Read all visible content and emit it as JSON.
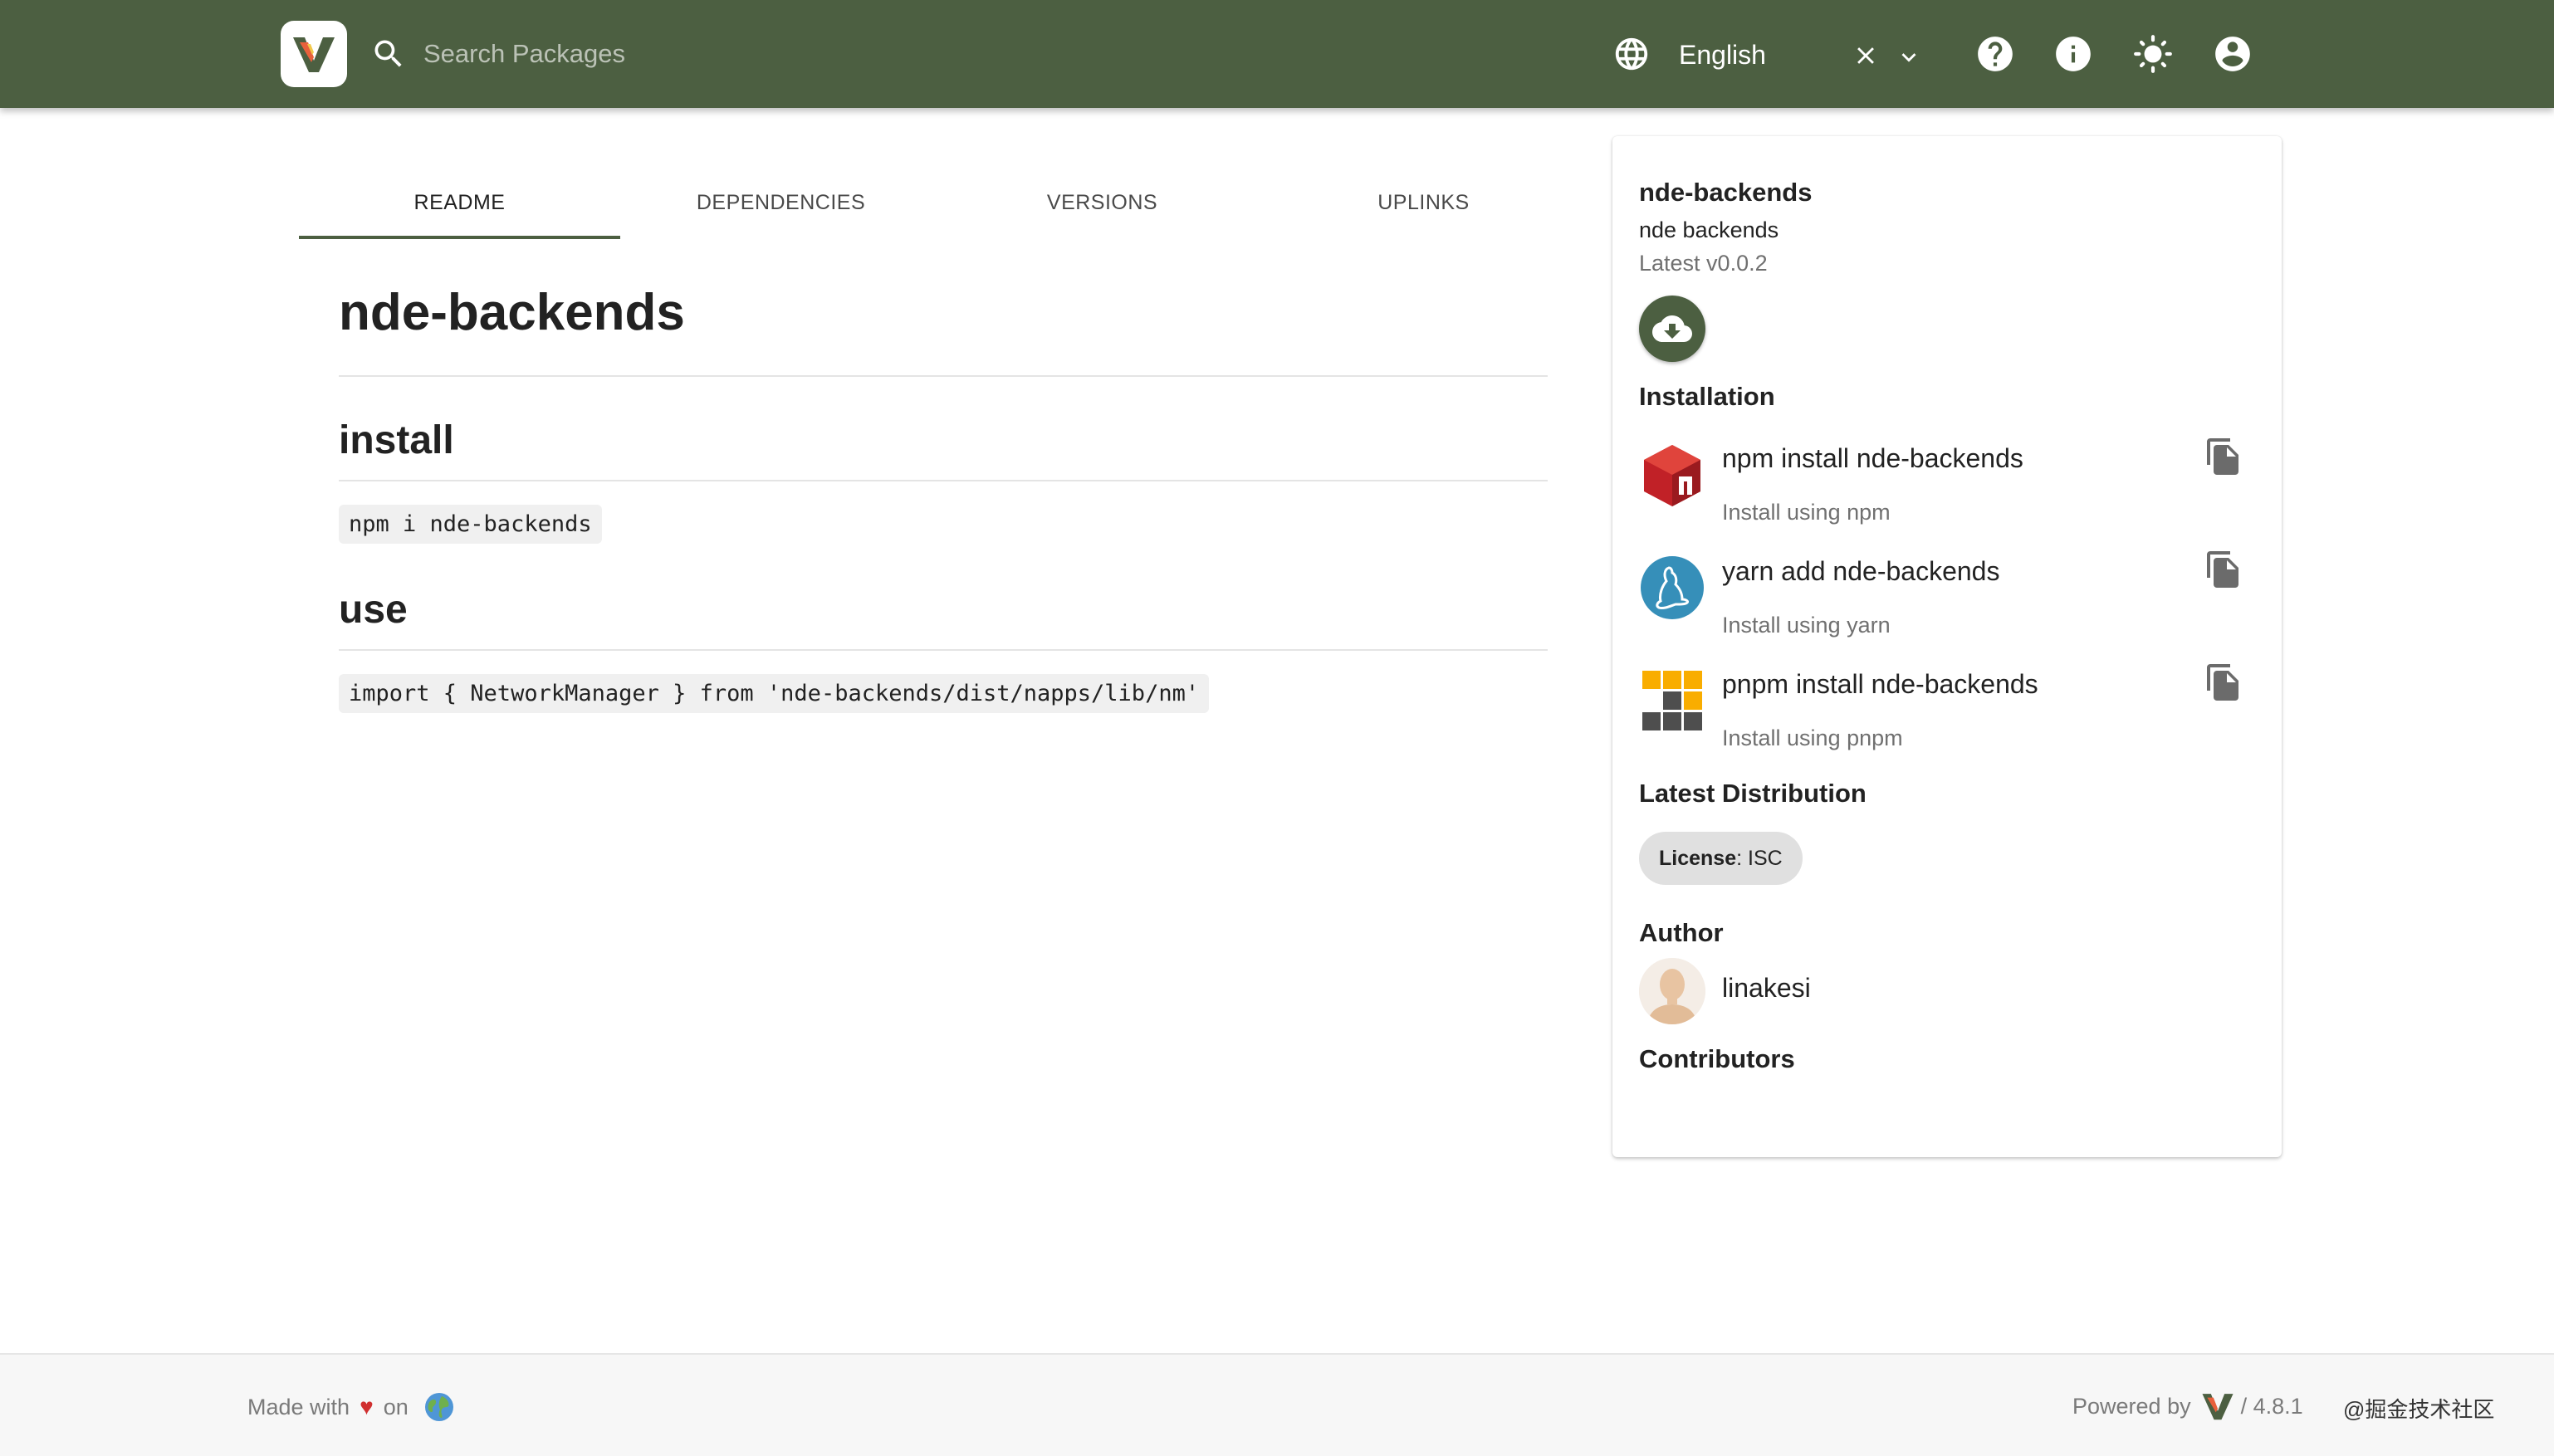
{
  "header": {
    "search_placeholder": "Search Packages",
    "language": "English",
    "icons": [
      "logo-icon",
      "search-icon",
      "globe-icon",
      "close-icon",
      "chevron-down-icon",
      "help-icon",
      "info-icon",
      "theme-sun-icon",
      "account-icon"
    ]
  },
  "tabs": [
    "README",
    "DEPENDENCIES",
    "VERSIONS",
    "UPLINKS"
  ],
  "active_tab": "README",
  "readme": {
    "title": "nde-backends",
    "install_heading": "install",
    "install_code": "npm i nde-backends",
    "use_heading": "use",
    "use_code": "import { NetworkManager } from 'nde-backends/dist/napps/lib/nm'"
  },
  "sidebar": {
    "name": "nde-backends",
    "description": "nde backends",
    "latest": "Latest v0.0.2",
    "installation_title": "Installation",
    "install_options": [
      {
        "command": "npm install nde-backends",
        "subtitle": "Install using npm",
        "icon": "npm-logo"
      },
      {
        "command": "yarn add nde-backends",
        "subtitle": "Install using yarn",
        "icon": "yarn-logo"
      },
      {
        "command": "pnpm install nde-backends",
        "subtitle": "Install using pnpm",
        "icon": "pnpm-logo"
      }
    ],
    "latest_distribution_title": "Latest Distribution",
    "license_label": "License",
    "license_value": ": ISC",
    "author_title": "Author",
    "author_name": "linakesi",
    "contributors_title": "Contributors"
  },
  "footer": {
    "made_with": "Made with",
    "on": "on",
    "powered_by": "Powered by",
    "version": "/ 4.8.1",
    "watermark": "@掘金技术社区"
  },
  "colors": {
    "brand": "#4c5f41",
    "heart": "#d03030"
  }
}
